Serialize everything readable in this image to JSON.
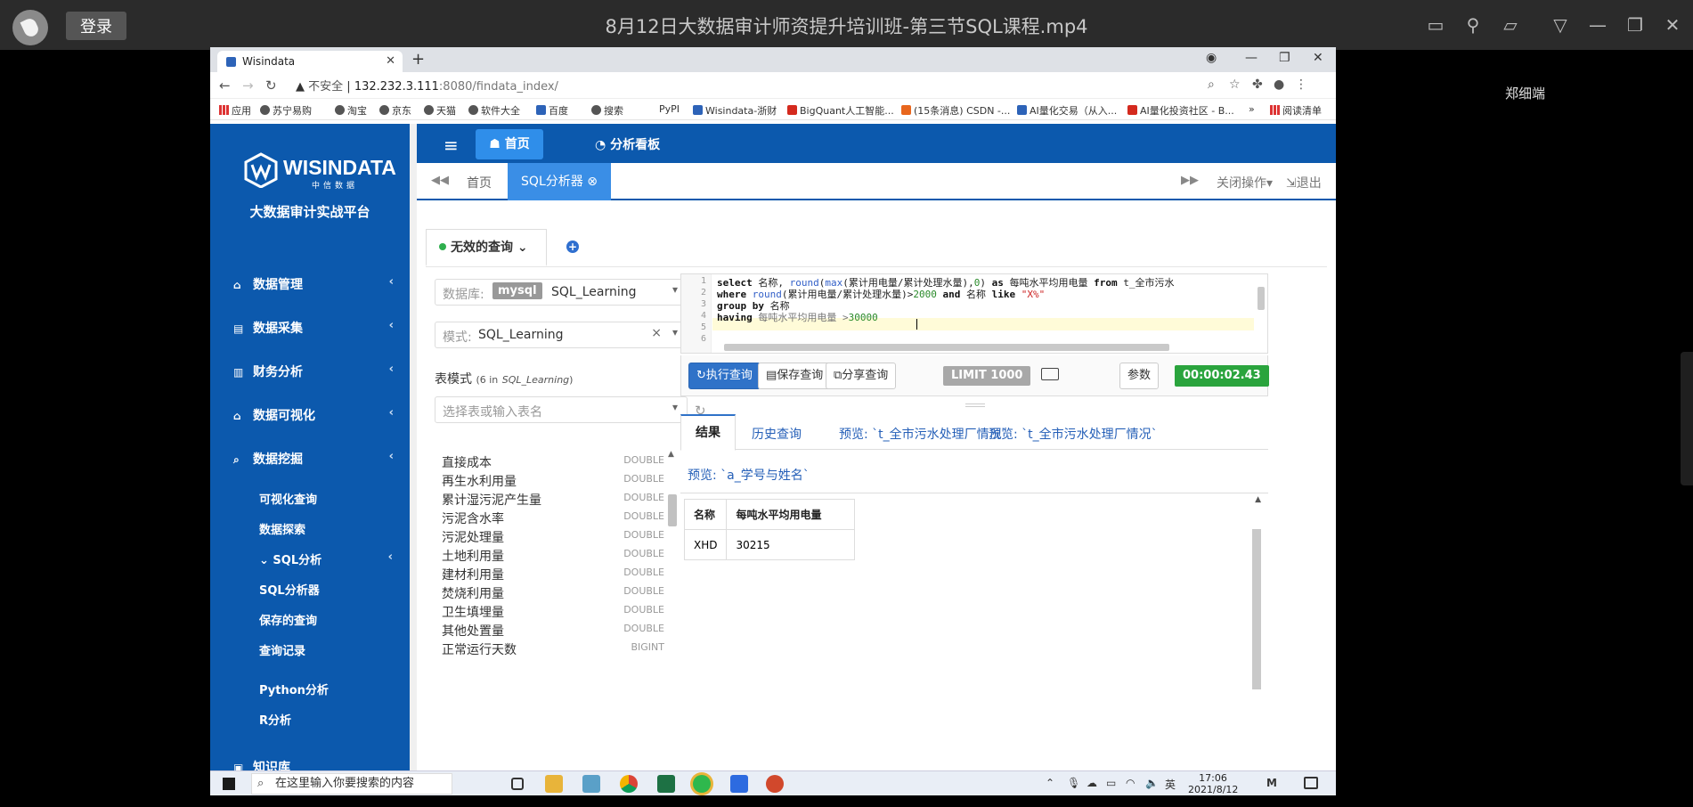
{
  "player": {
    "login": "登录",
    "title": "8月12日大数据审计师资提升培训班-第三节SQL课程.mp4",
    "watermark": "郑细端"
  },
  "browser": {
    "tab_title": "Wisindata",
    "insecure": "不安全",
    "host": "132.232.3.111",
    "path": ":8080/findata_index/",
    "bookmarks": [
      "应用",
      "苏宁易购",
      "淘宝",
      "京东",
      "天猫",
      "软件大全",
      "百度",
      "搜索",
      "PyPI",
      "Wisindata-浙财",
      "BigQuant人工智能...",
      "(15条消息) CSDN -...",
      "AI量化交易（从入...",
      "AI量化投资社区 - B...",
      "»",
      "阅读清单"
    ]
  },
  "sidebar": {
    "logo_text": "WISINDATA",
    "logo_sub": "中信数据",
    "platform": "大数据审计实战平台",
    "menu": [
      {
        "icon": "home-icon",
        "label": "数据管理"
      },
      {
        "icon": "database-icon",
        "label": "数据采集"
      },
      {
        "icon": "ledger-icon",
        "label": "财务分析"
      },
      {
        "icon": "home-icon",
        "label": "数据可视化"
      },
      {
        "icon": "search-icon",
        "label": "数据挖掘"
      }
    ],
    "submenu": [
      "可视化查询",
      "数据探索",
      "SQL分析",
      "SQL分析器",
      "保存的查询",
      "查询记录",
      "Python分析",
      "R分析"
    ],
    "bottom_item": "知识库"
  },
  "topnav": {
    "home": "首页",
    "board": "分析看板"
  },
  "tabbar": {
    "home": "首页",
    "sql_tab": "SQL分析器",
    "close_ops": "关闭操作",
    "exit": "退出"
  },
  "query": {
    "tab_label": "无效的查询",
    "db_label": "数据库:",
    "db_type": "mysql",
    "db_name": "SQL_Learning",
    "schema_label": "模式:",
    "schema_name": "SQL_Learning",
    "table_heading": "表模式",
    "table_count": "(6 in",
    "table_schema": "SQL_Learning",
    "table_close": ")",
    "table_placeholder": "选择表或输入表名"
  },
  "fields": [
    {
      "name": "直接成本",
      "type": "DOUBLE"
    },
    {
      "name": "再生水利用量",
      "type": "DOUBLE"
    },
    {
      "name": "累计湿污泥产生量",
      "type": "DOUBLE"
    },
    {
      "name": "污泥含水率",
      "type": "DOUBLE"
    },
    {
      "name": "污泥处理量",
      "type": "DOUBLE"
    },
    {
      "name": "土地利用量",
      "type": "DOUBLE"
    },
    {
      "name": "建材利用量",
      "type": "DOUBLE"
    },
    {
      "name": "焚烧利用量",
      "type": "DOUBLE"
    },
    {
      "name": "卫生填埋量",
      "type": "DOUBLE"
    },
    {
      "name": "其他处置量",
      "type": "DOUBLE"
    },
    {
      "name": "正常运行天数",
      "type": "BIGINT"
    }
  ],
  "editor": {
    "line_numbers": [
      "1",
      "2",
      "3",
      "4",
      "5",
      "6"
    ],
    "line1": {
      "a": "select",
      "b": " 名称, ",
      "c": "round",
      "d": "(",
      "e": "max",
      "f": "(累计用电量/累计处理水量),",
      "g": "0",
      "h": ") ",
      "i": "as",
      "j": " 每吨水平均用电量 ",
      "k": "from",
      "l": " t_全市污水"
    },
    "line2": {
      "a": "where",
      "b": " ",
      "c": "round",
      "d": "(累计用电量/累计处理水量)>",
      "e": "2000",
      "f": " ",
      "g": "and",
      "h": " 名称 ",
      "i": "like",
      "j": " ",
      "k": "\"X%\""
    },
    "line3": {
      "a": "group by",
      "b": " 名称"
    },
    "line4": {
      "a": "having",
      "b": " 每吨水平均用电量 >",
      "c": "30000"
    }
  },
  "buttons": {
    "run": "执行查询",
    "save": "保存查询",
    "share": "分享查询",
    "limit": "LIMIT 1000",
    "params": "参数",
    "timer": "00:00:02.43"
  },
  "results": {
    "tabs": [
      "结果",
      "历史查询",
      "预览: `t_全市污水处理厂情况`",
      "预览: `t_全市污水处理厂情况`"
    ],
    "preview3": "预览: `a_学号与姓名`",
    "columns": [
      "名称",
      "每吨水平均用电量"
    ],
    "rows": [
      [
        "XHD",
        "30215"
      ]
    ]
  },
  "taskbar": {
    "search": "在这里输入你要搜索的内容",
    "ime": "英",
    "time": "17:06",
    "date": "2021/8/12"
  }
}
